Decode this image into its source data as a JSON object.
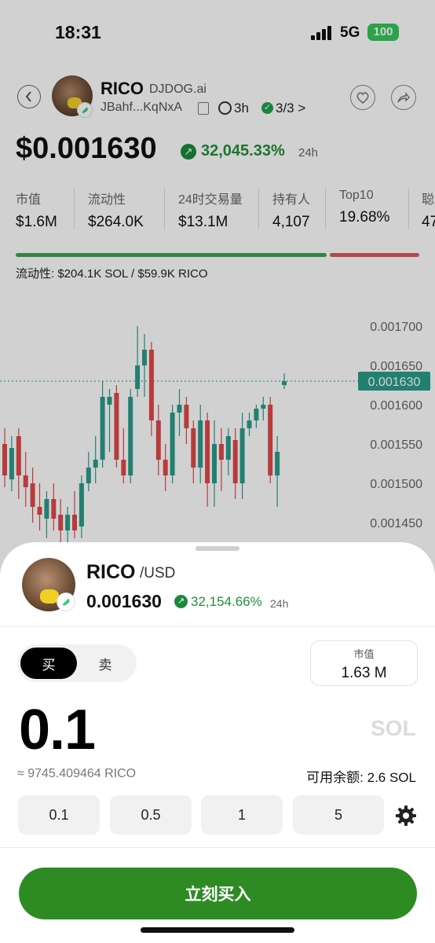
{
  "status_bar": {
    "time": "18:31",
    "network": "5G",
    "battery": "100"
  },
  "token": {
    "name": "RICO",
    "source": "DJDOG.ai",
    "address": "JBahf...KqNxA",
    "age": "3h",
    "checks": "3/3 >",
    "price": "$0.001630",
    "change": "32,045.33%",
    "change_period": "24h"
  },
  "stats": [
    {
      "label": "市值",
      "value": "$1.6M"
    },
    {
      "label": "流动性",
      "value": "$264.0K"
    },
    {
      "label": "24时交易量",
      "value": "$13.1M"
    },
    {
      "label": "持有人",
      "value": "4,107"
    },
    {
      "label": "Top10",
      "value": "19.68%"
    },
    {
      "label": "聪",
      "value": "47"
    }
  ],
  "liquidity": {
    "text": "流动性: $204.1K SOL / $59.9K RICO",
    "sol_share": 0.774
  },
  "chart_data": {
    "type": "candlestick",
    "price_ticks": [
      "0.001700",
      "0.001650",
      "0.001600",
      "0.001550",
      "0.001500",
      "0.001450"
    ],
    "current_price": "0.001630",
    "ylim": [
      0.00142,
      0.00172
    ],
    "up_color": "#2a9d8a",
    "down_color": "#e04848",
    "candles": [
      {
        "o": 0.00155,
        "h": 0.00157,
        "l": 0.001495,
        "c": 0.00151
      },
      {
        "o": 0.001505,
        "h": 0.00156,
        "l": 0.00149,
        "c": 0.001545
      },
      {
        "o": 0.00156,
        "h": 0.00157,
        "l": 0.00148,
        "c": 0.00151
      },
      {
        "o": 0.00151,
        "h": 0.00154,
        "l": 0.00147,
        "c": 0.001495
      },
      {
        "o": 0.0015,
        "h": 0.00152,
        "l": 0.00145,
        "c": 0.00147
      },
      {
        "o": 0.00147,
        "h": 0.0015,
        "l": 0.00144,
        "c": 0.00146
      },
      {
        "o": 0.001455,
        "h": 0.00149,
        "l": 0.00143,
        "c": 0.00148
      },
      {
        "o": 0.00148,
        "h": 0.0015,
        "l": 0.00144,
        "c": 0.001455
      },
      {
        "o": 0.00146,
        "h": 0.00148,
        "l": 0.00142,
        "c": 0.00144
      },
      {
        "o": 0.00144,
        "h": 0.00147,
        "l": 0.00142,
        "c": 0.00146
      },
      {
        "o": 0.00146,
        "h": 0.00149,
        "l": 0.00143,
        "c": 0.00144
      },
      {
        "o": 0.001445,
        "h": 0.00151,
        "l": 0.00143,
        "c": 0.0015
      },
      {
        "o": 0.0015,
        "h": 0.00154,
        "l": 0.00149,
        "c": 0.00152
      },
      {
        "o": 0.00152,
        "h": 0.00156,
        "l": 0.0015,
        "c": 0.00153
      },
      {
        "o": 0.00153,
        "h": 0.00163,
        "l": 0.00152,
        "c": 0.00161
      },
      {
        "o": 0.0016,
        "h": 0.00162,
        "l": 0.00154,
        "c": 0.00161
      },
      {
        "o": 0.001615,
        "h": 0.001625,
        "l": 0.00152,
        "c": 0.00153
      },
      {
        "o": 0.00153,
        "h": 0.00157,
        "l": 0.0015,
        "c": 0.00151
      },
      {
        "o": 0.00151,
        "h": 0.00162,
        "l": 0.0015,
        "c": 0.00161
      },
      {
        "o": 0.00162,
        "h": 0.0017,
        "l": 0.00161,
        "c": 0.00165
      },
      {
        "o": 0.00165,
        "h": 0.00169,
        "l": 0.00161,
        "c": 0.00167
      },
      {
        "o": 0.00167,
        "h": 0.00168,
        "l": 0.00156,
        "c": 0.00158
      },
      {
        "o": 0.00158,
        "h": 0.0016,
        "l": 0.00151,
        "c": 0.00153
      },
      {
        "o": 0.00153,
        "h": 0.00155,
        "l": 0.00149,
        "c": 0.00151
      },
      {
        "o": 0.00151,
        "h": 0.0016,
        "l": 0.0015,
        "c": 0.00159
      },
      {
        "o": 0.00159,
        "h": 0.00162,
        "l": 0.00156,
        "c": 0.0016
      },
      {
        "o": 0.0016,
        "h": 0.00161,
        "l": 0.00155,
        "c": 0.00157
      },
      {
        "o": 0.00157,
        "h": 0.00158,
        "l": 0.0015,
        "c": 0.00152
      },
      {
        "o": 0.00152,
        "h": 0.0016,
        "l": 0.0015,
        "c": 0.00158
      },
      {
        "o": 0.00158,
        "h": 0.00159,
        "l": 0.00147,
        "c": 0.0015
      },
      {
        "o": 0.0015,
        "h": 0.00158,
        "l": 0.00147,
        "c": 0.00155
      },
      {
        "o": 0.00155,
        "h": 0.00157,
        "l": 0.00149,
        "c": 0.00153
      },
      {
        "o": 0.00153,
        "h": 0.00157,
        "l": 0.00151,
        "c": 0.00156
      },
      {
        "o": 0.001555,
        "h": 0.00157,
        "l": 0.00148,
        "c": 0.0015
      },
      {
        "o": 0.0015,
        "h": 0.00159,
        "l": 0.00148,
        "c": 0.00157
      },
      {
        "o": 0.00157,
        "h": 0.00159,
        "l": 0.00156,
        "c": 0.00158
      },
      {
        "o": 0.00158,
        "h": 0.0016,
        "l": 0.00157,
        "c": 0.001595
      },
      {
        "o": 0.001595,
        "h": 0.00161,
        "l": 0.00158,
        "c": 0.0016
      },
      {
        "o": 0.0016,
        "h": 0.00161,
        "l": 0.0015,
        "c": 0.00151
      },
      {
        "o": 0.00151,
        "h": 0.00156,
        "l": 0.00147,
        "c": 0.00154
      },
      {
        "o": 0.001625,
        "h": 0.00164,
        "l": 0.00162,
        "c": 0.00163
      }
    ]
  },
  "sheet": {
    "symbol": "RICO",
    "pair": "/USD",
    "price": "0.001630",
    "change": "32,154.66%",
    "change_period": "24h",
    "tab_buy": "买",
    "tab_sell": "卖",
    "mcap_label": "市值",
    "mcap_value": "1.63 M",
    "amount": "0.1",
    "unit": "SOL",
    "approx": "≈ 9745.409464 RICO",
    "available": "可用余额: 2.6 SOL",
    "quick_amounts": [
      "0.1",
      "0.5",
      "1",
      "5"
    ],
    "buy_button": "立刻买入"
  }
}
